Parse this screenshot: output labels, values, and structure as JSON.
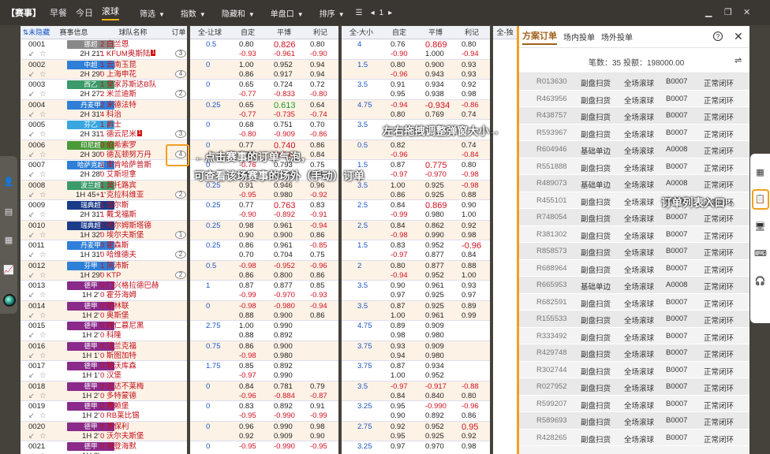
{
  "topbar": {
    "bracket": "【赛事】",
    "tabs": [
      "早餐",
      "今日",
      "滚球"
    ],
    "menus": [
      "筛选",
      "指数",
      "隐藏和",
      "单盘口",
      "排序"
    ],
    "page": "1"
  },
  "table": {
    "left_headers": [
      "⇅未隐藏",
      "赛事信息",
      "球队名称",
      "订单"
    ],
    "full_headers": [
      "全-让球",
      "自定",
      "平博",
      "利记"
    ],
    "total_headers": [
      "全-大小",
      "自定",
      "平博",
      "利记"
    ],
    "next_header": "全-独"
  },
  "rows": [
    {
      "id": "0001",
      "league": "挪超",
      "lc": "#888888",
      "time": "2H 21'",
      "t1": "2 白兰恩",
      "t2": "1 KFUM奥斯陆",
      "flag": "1",
      "bub": "3",
      "hc": "0.5",
      "h_self": [
        "0.80",
        "-0.93"
      ],
      "h_pb": [
        "0.826",
        "-0.961"
      ],
      "h_lj": [
        "0.80",
        "-0.90"
      ],
      "pbr": true,
      "tot": "4",
      "t_self": [
        "0.76",
        "-0.90"
      ],
      "t_pb": [
        "0.869",
        "1.000"
      ],
      "t_lj": [
        "0.80",
        "-0.94"
      ],
      "tpbr": true
    },
    {
      "id": "0002",
      "league": "中超",
      "lc": "#2f7fd8",
      "time": "2H 29'",
      "t1": "1 云南玉昆",
      "t2": "0 上海申花",
      "flag": "",
      "bub": "4",
      "hc": "0",
      "h_self": [
        "1.00",
        "0.86"
      ],
      "h_pb": [
        "0.952",
        "0.917"
      ],
      "h_lj": [
        "0.94",
        "0.94"
      ],
      "tot": "1.5",
      "t_self": [
        "0.80",
        "-0.96"
      ],
      "t_pb": [
        "0.900",
        "0.943"
      ],
      "t_lj": [
        "0.93",
        "0.93"
      ]
    },
    {
      "id": "0003",
      "league": "西乙",
      "lc": "#3c9a6a",
      "time": "2H 27'",
      "t1": "1 皇家苏斯达B队",
      "t2": "2 米兰迪斯",
      "flag": "",
      "bub": "2",
      "hc": "0",
      "h_self": [
        "0.65",
        "-0.77"
      ],
      "h_pb": [
        "0.724",
        "-0.833"
      ],
      "h_lj": [
        "0.72",
        "-0.80"
      ],
      "tot": "3.5",
      "t_self": [
        "0.91",
        "0.95"
      ],
      "t_pb": [
        "0.934",
        "0.938"
      ],
      "t_lj": [
        "0.92",
        "0.98"
      ]
    },
    {
      "id": "0004",
      "league": "丹麦甲",
      "lc": "#2f7fd8",
      "time": "2H 31'",
      "t1": "2 米德法特",
      "t2": "4 科治",
      "flag": "",
      "bub": "",
      "hc": "0.25",
      "h_self": [
        "0.65",
        "-0.77"
      ],
      "h_pb": [
        "0.613",
        "-0.735"
      ],
      "h_lj": [
        "0.64",
        "-0.74"
      ],
      "pbg": true,
      "tot": "4.75",
      "t_self": [
        "-0.94",
        "0.80"
      ],
      "t_pb": [
        "-0.934",
        "0.769"
      ],
      "t_lj": [
        "-0.86",
        "0.74"
      ],
      "tpbr": true
    },
    {
      "id": "0005",
      "league": "芬乙",
      "lc": "#3aa6e0",
      "time": "2H 31'",
      "t1": "1 爵士",
      "t2": "1 德云尼米",
      "flag": "1",
      "bub": "3",
      "hc": "0",
      "h_self": [
        "0.68",
        "-0.80"
      ],
      "h_pb": [
        "0.751",
        "-0.909"
      ],
      "h_lj": [
        "0.70",
        "-0.86"
      ],
      "tot": "3.5",
      "t_self": [
        "",
        ""
      ],
      "t_pb": [
        "",
        ""
      ],
      "t_lj": [
        "",
        ""
      ]
    },
    {
      "id": "0006",
      "league": "印尼超",
      "lc": "#4a9a3a",
      "time": "2H 30'",
      "t1": "0 伯希索罗",
      "t2": "0 德瓦顿努万丹",
      "flag": "",
      "bub": "4",
      "hc": "0",
      "h_self": [
        "0.77",
        "0.75"
      ],
      "h_pb": [
        "0.740",
        "-0.94"
      ],
      "h_lj": [
        "0.86",
        "0.84"
      ],
      "pbr": true,
      "tot": "0.5",
      "t_self": [
        "0.82",
        "-0.96"
      ],
      "t_pb": [
        "",
        ""
      ],
      "t_lj": [
        "0.74",
        "-0.84"
      ]
    },
    {
      "id": "0007",
      "league": "哈萨克超",
      "lc": "#2f7fd8",
      "time": "2H 28'",
      "t1": "1 東肯哈萨普斯",
      "t2": "0 艾斯坦拿",
      "flag": "",
      "bub": "",
      "hc": "0",
      "h_self": [
        "-0.76",
        "0.61"
      ],
      "h_pb": [
        "0.793",
        "0.718"
      ],
      "h_lj": [
        "0.75",
        "0.55"
      ],
      "tot": "1.5",
      "t_self": [
        "0.87",
        "-0.97"
      ],
      "t_pb": [
        "0.775",
        "-0.970"
      ],
      "t_lj": [
        "0.80",
        "-0.98"
      ],
      "tpbr": true
    },
    {
      "id": "0008",
      "league": "波兰超",
      "lc": "#3c9a6a",
      "time": "1H 45+1'",
      "t1": "1 莫托路宾",
      "t2": "1 克拉科维亚",
      "flag": "",
      "bub": "2",
      "hc": "0.25",
      "h_self": [
        "0.91",
        "-0.95"
      ],
      "h_pb": [
        "0.946",
        "0.980"
      ],
      "h_lj": [
        "0.96",
        "-0.92"
      ],
      "tot": "3.5",
      "t_self": [
        "1.00",
        "0.86"
      ],
      "t_pb": [
        "0.925",
        "0.925"
      ],
      "t_lj": [
        "-0.98",
        "0.88"
      ]
    },
    {
      "id": "0009",
      "league": "瑞典超",
      "lc": "#1a3a8a",
      "time": "2H 31'",
      "t1": "1 加尔斯",
      "t2": "1 戴戈福斯",
      "flag": "",
      "bub": "",
      "hc": "0.25",
      "h_self": [
        "0.77",
        "-0.90"
      ],
      "h_pb": [
        "0.763",
        "-0.892"
      ],
      "h_lj": [
        "0.83",
        "-0.91"
      ],
      "pbr": true,
      "tot": "2.5",
      "t_self": [
        "0.84",
        "-0.99"
      ],
      "t_pb": [
        "0.869",
        "0.980"
      ],
      "t_lj": [
        "0.90",
        "1.00"
      ],
      "tpbr": true
    },
    {
      "id": "0010",
      "league": "瑞典超",
      "lc": "#1a3a8a",
      "time": "1H 32'",
      "t1": "1 哈尔姆斯塔德",
      "t2": "0 埃尔夫斯堡",
      "flag": "",
      "bub": "1",
      "hc": "0.25",
      "h_self": [
        "0.98",
        "0.90"
      ],
      "h_pb": [
        "0.961",
        "0.900"
      ],
      "h_lj": [
        "-0.94",
        "0.86"
      ],
      "tot": "2.5",
      "t_self": [
        "0.84",
        "-0.98"
      ],
      "t_pb": [
        "0.862",
        "0.990"
      ],
      "t_lj": [
        "0.92",
        "0.98"
      ]
    },
    {
      "id": "0011",
      "league": "丹麦甲",
      "lc": "#2f7fd8",
      "time": "1H 31'",
      "t1": "0 霍森斯",
      "t2": "0 哈维德夫",
      "flag": "",
      "bub": "2",
      "hc": "0.25",
      "h_self": [
        "0.86",
        "0.70"
      ],
      "h_pb": [
        "0.961",
        "0.704"
      ],
      "h_lj": [
        "-0.85",
        "0.75"
      ],
      "tot": "1.5",
      "t_self": [
        "0.83",
        "-0.97"
      ],
      "t_pb": [
        "0.952",
        "0.877"
      ],
      "t_lj": [
        "-0.96",
        "0.84"
      ],
      "tplr": true
    },
    {
      "id": "0012",
      "league": "芬甲",
      "lc": "#2f7fd8",
      "time": "1H 29'",
      "t1": "1 简沛斯",
      "t2": "0 KTP",
      "flag": "",
      "bub": "2",
      "hc": "0.5",
      "h_self": [
        "-0.98",
        "0.86"
      ],
      "h_pb": [
        "-0.952",
        "0.800"
      ],
      "h_lj": [
        "-0.96",
        "0.86"
      ],
      "tot": "2",
      "t_self": [
        "0.80",
        "-0.94"
      ],
      "t_pb": [
        "0.877",
        "0.952"
      ],
      "t_lj": [
        "0.88",
        "1.00"
      ]
    },
    {
      "id": "0013",
      "league": "德甲",
      "lc": "#8a2a8a",
      "time": "1H 2'",
      "t1": "0 门兴格拉德巴赫",
      "t2": "0 霍芬海姆",
      "flag": "",
      "bub": "",
      "hc": "1",
      "h_self": [
        "0.87",
        "-0.99"
      ],
      "h_pb": [
        "0.877",
        "-0.970"
      ],
      "h_lj": [
        "0.85",
        "-0.93"
      ],
      "tot": "3.5",
      "t_self": [
        "0.90",
        "0.97"
      ],
      "t_pb": [
        "0.961",
        "0.925"
      ],
      "t_lj": [
        "0.93",
        "0.97"
      ]
    },
    {
      "id": "0014",
      "league": "德甲",
      "lc": "#8a2a8a",
      "time": "1H 2'",
      "t1": "0 柏林联",
      "t2": "0 奥斯堡",
      "flag": "",
      "bub": "",
      "hc": "0",
      "h_self": [
        "-0.98",
        "0.88"
      ],
      "h_pb": [
        "-0.980",
        "0.900"
      ],
      "h_lj": [
        "-0.94",
        "0.86"
      ],
      "tot": "3.5",
      "t_self": [
        "0.87",
        "1.00"
      ],
      "t_pb": [
        "0.925",
        "0.961"
      ],
      "t_lj": [
        "0.89",
        "0.99"
      ]
    },
    {
      "id": "0015",
      "league": "德甲",
      "lc": "#8a2a8a",
      "time": "1H 2'",
      "t1": "0 拜仁慕尼黑",
      "t2": "0 科隆",
      "flag": "",
      "bub": "",
      "hc": "2.75",
      "h_self": [
        "1.00",
        "0.88"
      ],
      "h_pb": [
        "0.990",
        "0.892"
      ],
      "h_lj": [
        "",
        ""
      ],
      "tot": "4.75",
      "t_self": [
        "0.89",
        "0.98"
      ],
      "t_pb": [
        "0.909",
        "0.980"
      ],
      "t_lj": [
        "",
        ""
      ]
    },
    {
      "id": "0016",
      "league": "德甲",
      "lc": "#8a2a8a",
      "time": "1H 1'",
      "t1": "0 法兰克福",
      "t2": "0 斯图加特",
      "flag": "",
      "bub": "",
      "hc": "0.75",
      "h_self": [
        "0.86",
        "-0.98"
      ],
      "h_pb": [
        "0.900",
        "0.980"
      ],
      "h_lj": [
        "",
        ""
      ],
      "tot": "3.75",
      "t_self": [
        "0.93",
        "0.94"
      ],
      "t_pb": [
        "0.909",
        "0.980"
      ],
      "t_lj": [
        "",
        ""
      ]
    },
    {
      "id": "0017",
      "league": "德甲",
      "lc": "#8a2a8a",
      "time": "1H 1'",
      "t1": "0 勒沃库森",
      "t2": "0 汉堡",
      "flag": "",
      "bub": "",
      "hc": "1.75",
      "h_self": [
        "0.85",
        "-0.97"
      ],
      "h_pb": [
        "0.892",
        "0.990"
      ],
      "h_lj": [
        "",
        ""
      ],
      "tot": "3.75",
      "t_self": [
        "0.87",
        "1.00"
      ],
      "t_pb": [
        "0.934",
        "0.952"
      ],
      "t_lj": [
        "",
        ""
      ]
    },
    {
      "id": "0018",
      "league": "德甲",
      "lc": "#8a2a8a",
      "time": "1H 2'",
      "t1": "0 云达不莱梅",
      "t2": "0 多特蒙德",
      "flag": "",
      "bub": "",
      "hc": "0",
      "h_self": [
        "0.84",
        "-0.96"
      ],
      "h_pb": [
        "0.781",
        "-0.884"
      ],
      "h_lj": [
        "0.79",
        "-0.87"
      ],
      "tot": "3.5",
      "t_self": [
        "-0.97",
        "0.84"
      ],
      "t_pb": [
        "-0.917",
        "0.840"
      ],
      "t_lj": [
        "-0.88",
        "0.80"
      ]
    },
    {
      "id": "0019",
      "league": "德甲",
      "lc": "#8a2a8a",
      "time": "1H 2'",
      "t1": "0 弗赖堡",
      "t2": "0 RB莱比锡",
      "flag": "",
      "bub": "",
      "hc": "0",
      "h_self": [
        "0.83",
        "-0.95"
      ],
      "h_pb": [
        "0.892",
        "-0.990"
      ],
      "h_lj": [
        "0.91",
        "-0.99"
      ],
      "tot": "3.25",
      "t_self": [
        "0.95",
        "0.90"
      ],
      "t_pb": [
        "-0.990",
        "0.892"
      ],
      "t_lj": [
        "-0.96",
        "0.86"
      ]
    },
    {
      "id": "0020",
      "league": "德甲",
      "lc": "#8a2a8a",
      "time": "1H 2'",
      "t1": "0 圣保利",
      "t2": "0 沃尔夫斯堡",
      "flag": "",
      "bub": "",
      "hc": "0",
      "h_self": [
        "0.96",
        "0.92"
      ],
      "h_pb": [
        "0.990",
        "0.909"
      ],
      "h_lj": [
        "0.98",
        "0.90"
      ],
      "tot": "2.75",
      "t_self": [
        "0.92",
        "0.95"
      ],
      "t_pb": [
        "0.952",
        "0.925"
      ],
      "t_lj": [
        "0.95",
        "0.92"
      ],
      "tplr": true
    },
    {
      "id": "0021",
      "league": "德甲",
      "lc": "#8a2a8a",
      "time": "1H 2'",
      "t1": "0 海登海默",
      "t2": "",
      "flag": "",
      "bub": "",
      "hc": "0",
      "h_self": [
        "-0.95",
        ""
      ],
      "h_pb": [
        "-0.990",
        ""
      ],
      "h_lj": [
        "-0.95",
        ""
      ],
      "tot": "3.25",
      "t_self": [
        "0.97",
        ""
      ],
      "t_pb": [
        "0.970",
        ""
      ],
      "t_lj": [
        "0.98",
        ""
      ]
    }
  ],
  "panel": {
    "tab_main": "方案订单",
    "tab_in": "场内投单",
    "tab_out": "场外投单",
    "count_label": "笔数：35",
    "stake_label": "投额：198000.00",
    "orders": [
      [
        "R013630",
        "副盘扫货",
        "全场滚球",
        "B0007",
        "正常闭环"
      ],
      [
        "R463956",
        "副盘扫货",
        "全场滚球",
        "B0007",
        "正常闭环"
      ],
      [
        "R438757",
        "副盘扫货",
        "全场滚球",
        "B0007",
        "正常闭环"
      ],
      [
        "R593967",
        "副盘扫货",
        "全场滚球",
        "B0007",
        "正常闭环"
      ],
      [
        "R604946",
        "基础单边",
        "全场滚球",
        "A0008",
        "正常闭环"
      ],
      [
        "R551888",
        "副盘扫货",
        "全场滚球",
        "B0007",
        "正常闭环"
      ],
      [
        "R489073",
        "基础单边",
        "全场滚球",
        "A0008",
        "正常闭环"
      ],
      [
        "R455101",
        "副盘扫货",
        "全场滚球",
        "B0007",
        "正常闭环"
      ],
      [
        "R748054",
        "副盘扫货",
        "全场滚球",
        "B0007",
        "正常闭环"
      ],
      [
        "R381302",
        "副盘扫货",
        "全场滚球",
        "B0007",
        "正常闭环"
      ],
      [
        "R858573",
        "副盘扫货",
        "全场滚球",
        "B0007",
        "正常闭环"
      ],
      [
        "R688964",
        "副盘扫货",
        "全场滚球",
        "B0007",
        "正常闭环"
      ],
      [
        "R665953",
        "基础单边",
        "全场滚球",
        "A0008",
        "正常闭环"
      ],
      [
        "R682591",
        "副盘扫货",
        "全场滚球",
        "B0007",
        "正常闭环"
      ],
      [
        "R155533",
        "副盘扫货",
        "全场滚球",
        "B0007",
        "正常闭环"
      ],
      [
        "R333492",
        "副盘扫货",
        "全场滚球",
        "B0007",
        "正常闭环"
      ],
      [
        "R429748",
        "副盘扫货",
        "全场滚球",
        "B0007",
        "正常闭环"
      ],
      [
        "R302744",
        "副盘扫货",
        "全场滚球",
        "B0007",
        "正常闭环"
      ],
      [
        "R027952",
        "副盘扫货",
        "全场滚球",
        "B0007",
        "正常闭环"
      ],
      [
        "R599207",
        "副盘扫货",
        "全场滚球",
        "B0007",
        "正常闭环"
      ],
      [
        "R589693",
        "副盘扫货",
        "全场滚球",
        "B0007",
        "正常闭环"
      ],
      [
        "R428265",
        "副盘扫货",
        "全场滚球",
        "B0007",
        "正常闭环"
      ]
    ]
  },
  "annotations": {
    "bubble_hint_1": "←点击赛事的订单气泡，",
    "bubble_hint_2": "可查看该场赛事的场外（手动）订单",
    "resize_hint": "左右拖拽调整弹窗大小→",
    "entry_hint": "订单列表入口→"
  },
  "colors": {
    "accent": "#f0a020",
    "header_bg": "#3a3632",
    "odds_blue": "#1a56c8",
    "odds_red": "#d0101f"
  }
}
